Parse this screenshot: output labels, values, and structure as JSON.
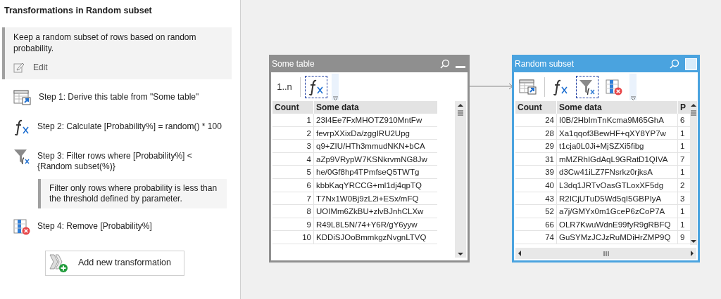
{
  "sidebar": {
    "title": "Transformations in Random subset",
    "description": "Keep a random subset of rows based on random probability.",
    "edit_label": "Edit",
    "steps": [
      {
        "kind": "derive",
        "text": "Step 1: Derive this table from \"Some table\""
      },
      {
        "kind": "calc",
        "text": "Step 2: Calculate [Probability%] = random() * 100"
      },
      {
        "kind": "filter",
        "text": "Step 3: Filter rows where [Probability%] < {Random subset(%)}",
        "note": "Filter only rows where probability is less than the threshold defined by parameter."
      },
      {
        "kind": "remove",
        "text": "Step 4: Remove [Probability%]"
      }
    ],
    "add_button": "Add new transformation"
  },
  "canvas": {
    "tables": [
      {
        "title": "Some table",
        "selected": false,
        "tools": [
          {
            "kind": "rownum",
            "label": "1..n",
            "selected": false
          },
          {
            "kind": "calc",
            "selected": true
          }
        ],
        "columns": [
          "Count",
          "Some data"
        ],
        "rows": [
          [
            "1",
            "23I4Ee7FxMHOTZ910MntFw"
          ],
          [
            "2",
            "fevrpXXixDa/zggIRU2Upg"
          ],
          [
            "3",
            "q9+ZIU/HTh3mmudNKN+bCA"
          ],
          [
            "4",
            "aZp9VRypW7KSNkrvmNG8Jw"
          ],
          [
            "5",
            "he/0Gf8hp4TPmfseQ5TWTg"
          ],
          [
            "6",
            "kbbKaqYRCCG+ml1dj4qpTQ"
          ],
          [
            "7",
            "T7Nx1W0Bj9zL2i+ESx/mFQ"
          ],
          [
            "8",
            "UOIMm6ZkBU+zlvBJnhCLXw"
          ],
          [
            "9",
            "R49L8L5N/74+Y6R/gY6yyw"
          ],
          [
            "10",
            "KDDiSJOoBmmkgzNvgnLTVQ"
          ]
        ]
      },
      {
        "title": "Random subset",
        "selected": true,
        "tools": [
          {
            "kind": "derive",
            "selected": false
          },
          {
            "kind": "calc",
            "selected": false
          },
          {
            "kind": "filter",
            "selected": true
          },
          {
            "kind": "remove",
            "selected": false
          }
        ],
        "columns": [
          "Count",
          "Some data",
          "P"
        ],
        "rows": [
          [
            "24",
            "I0B/2HbImTnKcma9M65GhA",
            "6"
          ],
          [
            "28",
            "Xa1qqof3BewHF+qXY8YP7w",
            "1"
          ],
          [
            "29",
            "t1cja0L0Ji+MjSZXi5fibg",
            "1"
          ],
          [
            "31",
            "mMZRhIGdAqL9GRatD1QIVA",
            "7"
          ],
          [
            "39",
            "d3Cw41iLZ7FNsrkz0rjksA",
            "1"
          ],
          [
            "40",
            "L3dq1JRTvOasGTLoxXF5dg",
            "2"
          ],
          [
            "43",
            "R2ICjUTuD5Wd5qI5GBPIyA",
            "3"
          ],
          [
            "52",
            "a7j/GMYx0m1GceP6zCoP7A",
            "1"
          ],
          [
            "66",
            "OLR7KwuWdnE99fyR9gRBFQ",
            "1"
          ],
          [
            "74",
            "GuSYMzJCJzRuMDiHrZMP9Q",
            "9"
          ]
        ]
      }
    ]
  }
}
